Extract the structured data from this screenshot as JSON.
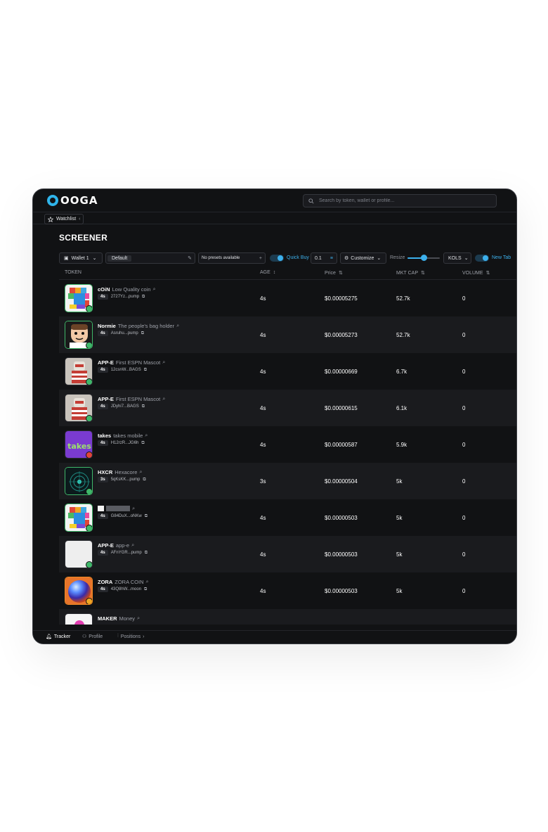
{
  "app": {
    "logo_text": "OOGA",
    "brand_color": "#3cb0ec"
  },
  "search": {
    "placeholder": "Search by token, wallet or profile..."
  },
  "watchlist": {
    "label": "Watchlist"
  },
  "page": {
    "title": "SCREENER"
  },
  "toolbar": {
    "wallet": "Wallet 1",
    "preset_default": "Default",
    "presets_empty": "No presets available",
    "quick_buy_label": "Quick Buy",
    "quick_buy_amount": "0.1",
    "customize": "Customize",
    "resize": "Resize",
    "kols": "KOLS",
    "new_tab": "New Tab",
    "resize_level_percent": 50
  },
  "columns": {
    "token": "TOKEN",
    "age": "AGE",
    "price": "Price",
    "mktcap": "MKT CAP",
    "volume": "VOLUME"
  },
  "rows": [
    {
      "ticker": "cOiN",
      "name": "Low Quality coin",
      "age": "4s",
      "address": "2727Yz...pump",
      "price": "$0.00005275",
      "mktcap": "52.7k",
      "volume": "0"
    },
    {
      "ticker": "Normie",
      "name": "The people's bag holder",
      "age": "4s",
      "address": "Asruhu...pump",
      "price": "$0.00005273",
      "mktcap": "52.7k",
      "volume": "0"
    },
    {
      "ticker": "APP-E",
      "name": "First ESPN Mascot",
      "age": "4s",
      "address": "12csnW...BAGS",
      "price": "$0.00000669",
      "mktcap": "6.7k",
      "volume": "0"
    },
    {
      "ticker": "APP-E",
      "name": "First ESPN Mascot",
      "age": "4s",
      "address": "JDyhi7...BAGS",
      "price": "$0.00000615",
      "mktcap": "6.1k",
      "volume": "0"
    },
    {
      "ticker": "takes",
      "name": "takes mobile",
      "age": "4s",
      "address": "H12rzR...JG6h",
      "price": "$0.00000587",
      "mktcap": "5.9k",
      "volume": "0"
    },
    {
      "ticker": "HXCR",
      "name": "Hexacore",
      "age": "3s",
      "address": "5qKsKK...pump",
      "price": "$0.00000504",
      "mktcap": "5k",
      "volume": "0"
    },
    {
      "ticker": "",
      "name": "",
      "age": "4s",
      "address": "G84DuX...oNKw",
      "price": "$0.00000503",
      "mktcap": "5k",
      "volume": "0"
    },
    {
      "ticker": "APP-E",
      "name": "app-e",
      "age": "4s",
      "address": "AFnYGR...pump",
      "price": "$0.00000503",
      "mktcap": "5k",
      "volume": "0"
    },
    {
      "ticker": "ZORA",
      "name": "ZORA COIN",
      "age": "4s",
      "address": "43Q8hW...moon",
      "price": "$0.00000503",
      "mktcap": "5k",
      "volume": "0"
    },
    {
      "ticker": "MAKER",
      "name": "Money",
      "age": "",
      "address": "",
      "price": "",
      "mktcap": "",
      "volume": ""
    }
  ],
  "bottom_nav": {
    "tracker": "Tracker",
    "profile": "Profile",
    "positions": "Positions"
  },
  "colors": {
    "positive": "#3fb86a",
    "panel": "#111214",
    "accent": "#3cb0ec"
  }
}
